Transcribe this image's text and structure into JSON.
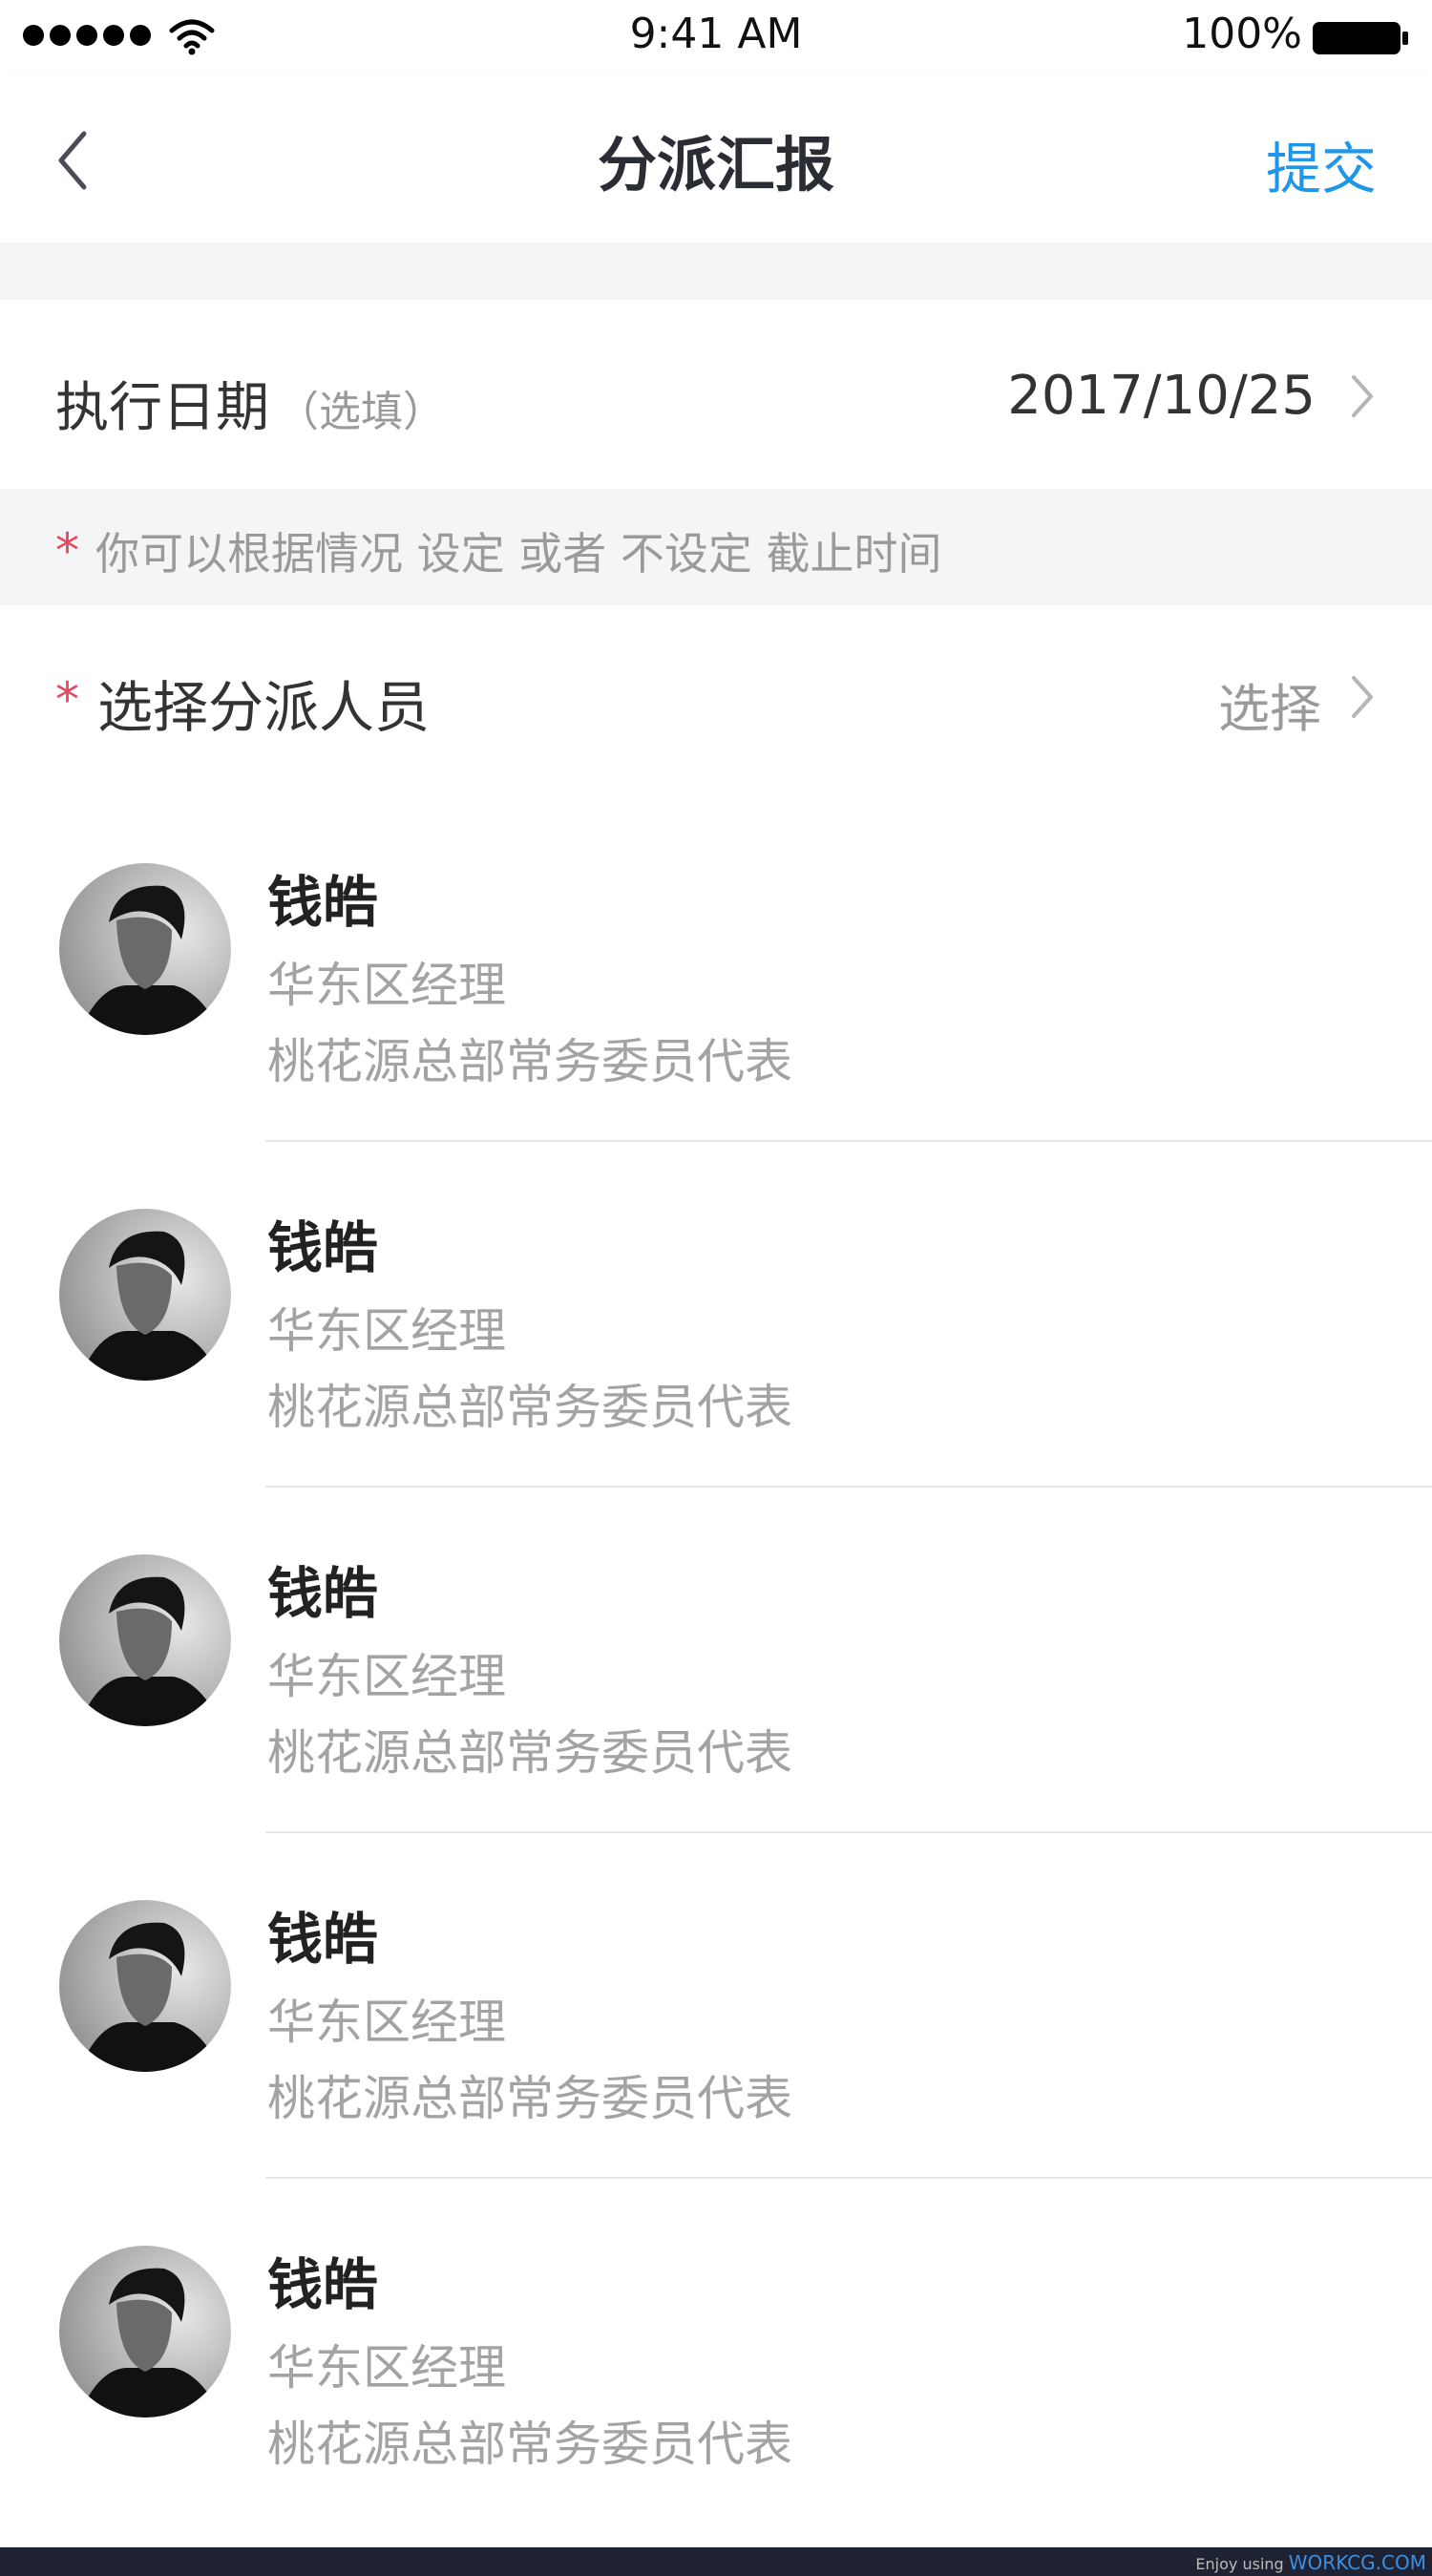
{
  "status_bar": {
    "time": "9:41 AM",
    "battery": "100%"
  },
  "nav": {
    "title": "分派汇报",
    "submit_label": "提交",
    "back_icon": "chevron-left-icon"
  },
  "date_row": {
    "label": "执行日期",
    "optional_hint": "（选填）",
    "value": "2017/10/25"
  },
  "hint": {
    "star": "*",
    "text": "你可以根据情况 设定 或者 不设定 截止时间"
  },
  "assignee": {
    "star": "*",
    "label": "选择分派人员",
    "action": "选择"
  },
  "people": [
    {
      "name": "钱皓",
      "title": "华东区经理",
      "dept": "桃花源总部常务委员代表"
    },
    {
      "name": "钱皓",
      "title": "华东区经理",
      "dept": "桃花源总部常务委员代表"
    },
    {
      "name": "钱皓",
      "title": "华东区经理",
      "dept": "桃花源总部常务委员代表"
    },
    {
      "name": "钱皓",
      "title": "华东区经理",
      "dept": "桃花源总部常务委员代表"
    },
    {
      "name": "钱皓",
      "title": "华东区经理",
      "dept": "桃花源总部常务委员代表"
    }
  ],
  "footer": {
    "prefix": "Enjoy using",
    "brand": "WORKCG.COM"
  },
  "colors": {
    "accent": "#2196e8",
    "required_star": "#e9455b",
    "muted_text": "#9a9a9a",
    "section_bg": "#f4f5f7"
  }
}
